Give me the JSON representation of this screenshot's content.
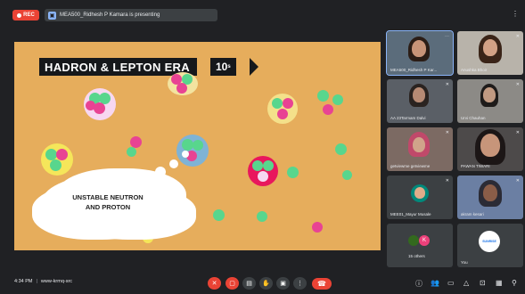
{
  "recording": {
    "label": "REC"
  },
  "presenting": {
    "text": "MEA500_Ridhesh P Kamara is presenting"
  },
  "slide": {
    "banner_title": "HADRON & LEPTON ERA",
    "banner_time": "10",
    "banner_time_unit": "s",
    "cloud_line1": "UNSTABLE NEUTRON",
    "cloud_line2": "AND PROTON"
  },
  "participants": [
    {
      "name": "MEA500_Ridhesh P Kar..."
    },
    {
      "name": "Anushka Bhoir"
    },
    {
      "name": "AA 23Tarmam Dalvi"
    },
    {
      "name": "Urvi Chauhan"
    },
    {
      "name": "getviewme getviewme"
    },
    {
      "name": "PAWAN TIWARI"
    },
    {
      "name": "MEE01_Mayur Musale"
    },
    {
      "name": "akram kesari"
    }
  ],
  "others": {
    "label": "15 others",
    "avatar_letter": "K"
  },
  "you": {
    "label": "You",
    "logo_text": "SUNRISE"
  },
  "bottom": {
    "time": "4:34 PM",
    "separator": "|",
    "meeting_code": "www-krmq-src"
  },
  "icons": {
    "mic": "mic-off-icon",
    "cam": "camera-off-icon",
    "cc": "captions-icon",
    "hand": "raise-hand-icon",
    "present": "present-icon",
    "more": "more-options-icon",
    "end": "end-call-icon",
    "info": "info-icon",
    "people": "people-icon",
    "chat": "chat-icon",
    "shapes": "activities-icon",
    "lock": "host-controls-icon"
  },
  "colors": {
    "accent": "#8ab4f8",
    "danger": "#ea4335",
    "background": "#202124",
    "slide_bg": "#e6ad5c"
  }
}
